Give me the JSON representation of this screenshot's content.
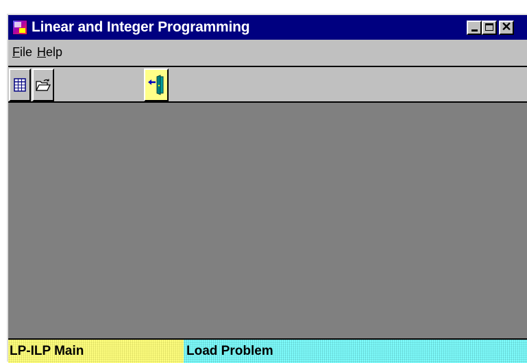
{
  "window": {
    "title": "Linear and Integer Programming",
    "app_icon": "lp-app-icon",
    "controls": {
      "minimize_icon": "minimize-icon",
      "maximize_icon": "maximize-icon",
      "close_glyph": "✕"
    }
  },
  "menu": {
    "file": {
      "mnemonic": "F",
      "rest": "ile"
    },
    "help": {
      "mnemonic": "H",
      "rest": "elp"
    }
  },
  "toolbar": {
    "buttons": [
      {
        "icon": "new-table-icon"
      },
      {
        "icon": "open-folder-icon"
      },
      {
        "icon": "exit-door-icon",
        "highlight_color": "#ffff88"
      }
    ]
  },
  "status": {
    "left": "LP-ILP Main",
    "right": "Load Problem",
    "left_color": "#ffff80",
    "right_color": "#80ffff"
  },
  "colors": {
    "titlebar": "#000080",
    "workspace": "#808080",
    "chrome": "#c0c0c0"
  }
}
